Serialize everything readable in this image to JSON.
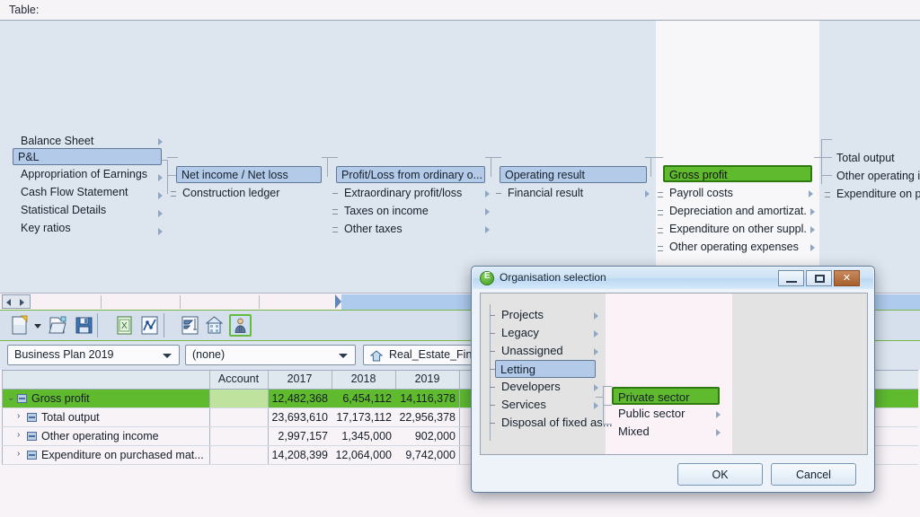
{
  "topbar": {
    "label": "Table:"
  },
  "tree": {
    "col1": [
      {
        "label": "Balance Sheet",
        "state": "plain",
        "arrow": true
      },
      {
        "label": "P&L",
        "state": "selected",
        "arrow": false
      },
      {
        "label": "Appropriation of Earnings",
        "state": "plain",
        "arrow": true
      },
      {
        "label": "Cash Flow Statement",
        "state": "plain",
        "arrow": true
      },
      {
        "label": "Statistical Details",
        "state": "plain",
        "arrow": true
      },
      {
        "label": "Key ratios",
        "state": "plain",
        "arrow": true
      }
    ],
    "col2": [
      {
        "label": "Net income / Net loss",
        "state": "selected",
        "arrow": false
      },
      {
        "label": "Construction ledger",
        "state": "plain",
        "arrow": false
      }
    ],
    "col3": [
      {
        "label": "Profit/Loss from ordinary o...",
        "state": "selected",
        "arrow": false
      },
      {
        "label": "Extraordinary profit/loss",
        "state": "plain",
        "arrow": true
      },
      {
        "label": "Taxes on income",
        "state": "plain",
        "arrow": true
      },
      {
        "label": "Other taxes",
        "state": "plain",
        "arrow": true
      }
    ],
    "col4": [
      {
        "label": "Operating result",
        "state": "selected",
        "arrow": false
      },
      {
        "label": "Financial result",
        "state": "plain",
        "arrow": true
      }
    ],
    "col5": [
      {
        "label": "Gross profit",
        "state": "green",
        "arrow": false
      },
      {
        "label": "Payroll costs",
        "state": "plain",
        "arrow": true
      },
      {
        "label": "Depreciation and amortizat.",
        "state": "plain",
        "arrow": true
      },
      {
        "label": "Expenditure on other suppl.",
        "state": "plain",
        "arrow": true
      },
      {
        "label": "Other operating expenses",
        "state": "plain",
        "arrow": true
      }
    ],
    "col6": [
      {
        "label": "Total output",
        "state": "plain",
        "arrow": false
      },
      {
        "label": "Other operating i",
        "state": "plain",
        "arrow": false
      },
      {
        "label": "Expenditure on p",
        "state": "plain",
        "arrow": false
      }
    ]
  },
  "toolbar": {
    "icons": [
      "new-document-icon",
      "dropdown-arrow-icon",
      "open-folder-icon",
      "save-disk-icon",
      "excel-export-icon",
      "chart-icon",
      "sort-filter-icon",
      "building-icon",
      "person-icon"
    ],
    "active_icon": "person-icon",
    "accent_green": "#79b648"
  },
  "selectors": {
    "plan": {
      "value": "Business Plan 2019"
    },
    "scenario": {
      "value": "(none)"
    },
    "entity": {
      "value": "Real_Estate_Fina",
      "icon": "home-icon"
    }
  },
  "table": {
    "columns": [
      "",
      "Account",
      "2017",
      "2018",
      "2019"
    ],
    "rows": [
      {
        "label": "Gross profit",
        "indent": 0,
        "expanded": true,
        "highlight": true,
        "values": [
          "12,482,368",
          "6,454,112",
          "14,116,378"
        ]
      },
      {
        "label": "Total output",
        "indent": 1,
        "expanded": false,
        "highlight": false,
        "values": [
          "23,693,610",
          "17,173,112",
          "22,956,378"
        ]
      },
      {
        "label": "Other operating income",
        "indent": 1,
        "expanded": false,
        "highlight": false,
        "values": [
          "2,997,157",
          "1,345,000",
          "902,000"
        ]
      },
      {
        "label": "Expenditure on purchased mat...",
        "indent": 1,
        "expanded": false,
        "highlight": false,
        "values": [
          "14,208,399",
          "12,064,000",
          "9,742,000"
        ]
      }
    ]
  },
  "dialog": {
    "title": "Organisation selection",
    "title_icon": "euro-globe-icon",
    "window_buttons": {
      "minimize": "minimize-button",
      "maximize": "maximize-button",
      "close": "close-button"
    },
    "col1": [
      {
        "label": "Projects",
        "state": "plain",
        "arrow": true
      },
      {
        "label": "Legacy",
        "state": "plain",
        "arrow": true
      },
      {
        "label": "Unassigned",
        "state": "plain",
        "arrow": true
      },
      {
        "label": "Letting",
        "state": "selected",
        "arrow": false
      },
      {
        "label": "Developers",
        "state": "plain",
        "arrow": true
      },
      {
        "label": "Services",
        "state": "plain",
        "arrow": true
      },
      {
        "label": "Disposal of fixed as...",
        "state": "plain",
        "arrow": false
      }
    ],
    "col2": [
      {
        "label": "Private sector",
        "state": "green",
        "arrow": false
      },
      {
        "label": "Public sector",
        "state": "plain",
        "arrow": true
      },
      {
        "label": "Mixed",
        "state": "plain",
        "arrow": true
      }
    ],
    "ok": "OK",
    "cancel": "Cancel"
  },
  "colors": {
    "green_highlight": "#5fba2e",
    "blue_selection": "#b3cbe8",
    "panel_bg": "#dde5ee"
  }
}
